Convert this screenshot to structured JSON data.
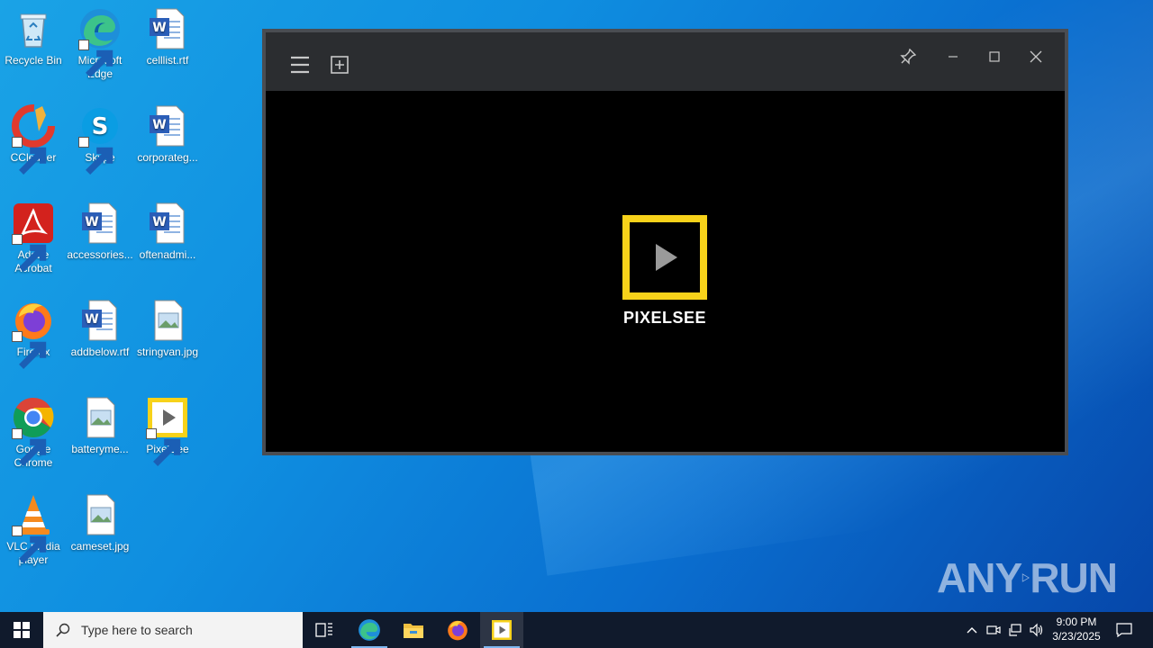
{
  "desktop": {
    "icons": [
      {
        "label": "Recycle Bin"
      },
      {
        "label": "Microsoft Edge"
      },
      {
        "label": "celllist.rtf"
      },
      {
        "label": "CCleaner"
      },
      {
        "label": "Skype"
      },
      {
        "label": "corporateg..."
      },
      {
        "label": "Adobe Acrobat"
      },
      {
        "label": "accessories..."
      },
      {
        "label": "oftenadmi..."
      },
      {
        "label": "Firefox"
      },
      {
        "label": "addbelow.rtf"
      },
      {
        "label": "stringvan.jpg"
      },
      {
        "label": "Google Chrome"
      },
      {
        "label": "batteryme..."
      },
      {
        "label": "PixelSee"
      },
      {
        "label": "VLC media player"
      },
      {
        "label": "cameset.jpg"
      }
    ]
  },
  "window": {
    "app_name": "PIXELSEE",
    "accent": "#f7d21a"
  },
  "taskbar": {
    "search_placeholder": "Type here to search",
    "time": "9:00 PM",
    "date": "3/23/2025"
  },
  "watermark": {
    "left": "ANY",
    "right": "RUN"
  }
}
